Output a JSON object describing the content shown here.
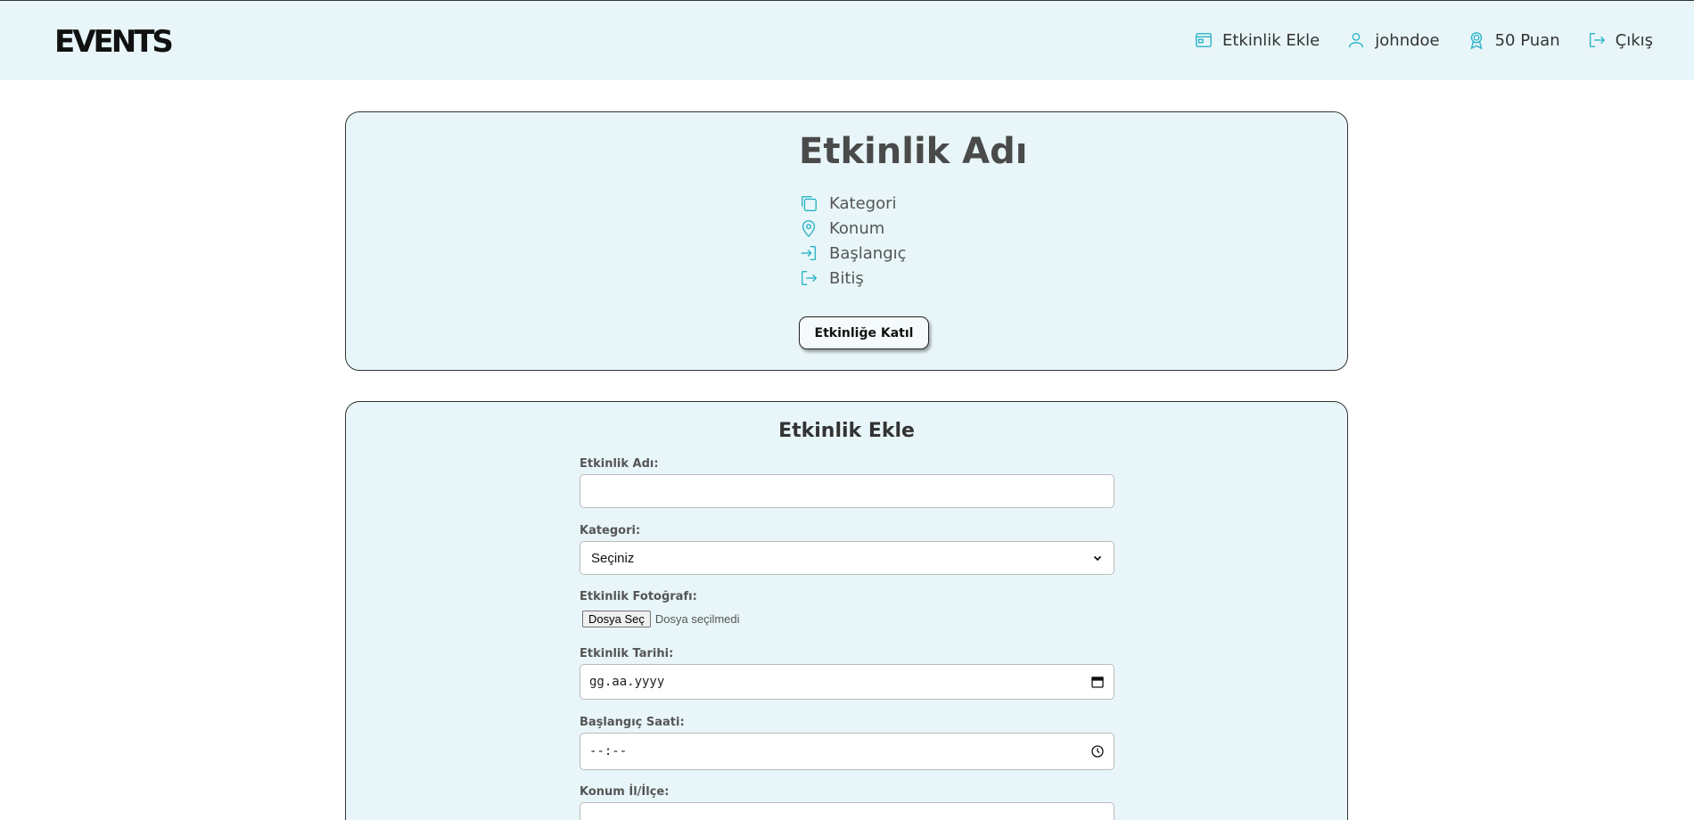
{
  "header": {
    "logo": "EVENTS",
    "nav": [
      {
        "label": "Etkinlik Ekle",
        "icon": "calendar-card-icon"
      },
      {
        "label": "johndoe",
        "icon": "user-icon"
      },
      {
        "label": "50 Puan",
        "icon": "award-icon"
      },
      {
        "label": "Çıkış",
        "icon": "logout-icon"
      }
    ]
  },
  "event_card": {
    "title": "Etkinlik Adı",
    "meta": [
      {
        "label": "Kategori",
        "icon": "copy-icon"
      },
      {
        "label": "Konum",
        "icon": "map-pin-icon"
      },
      {
        "label": "Başlangıç",
        "icon": "sign-in-icon"
      },
      {
        "label": "Bitiş",
        "icon": "sign-out-icon"
      }
    ],
    "join_button": "Etkinliğe Katıl"
  },
  "form": {
    "title": "Etkinlik Ekle",
    "name_label": "Etkinlik Adı:",
    "name_value": "",
    "category_label": "Kategori:",
    "category_value": "Seçiniz",
    "photo_label": "Etkinlik Fotoğrafı:",
    "photo_button": "Dosya Seç",
    "photo_status": "Dosya seçilmedi",
    "date_label": "Etkinlik Tarihi:",
    "date_placeholder": "gg.aa.yyyy",
    "start_time_label": "Başlangıç Saati:",
    "start_time_placeholder": "--:--",
    "location_label": "Konum İl/İlçe:",
    "location_value": ""
  },
  "colors": {
    "accent": "#2bb3c6",
    "panel_bg": "#e8f6f9"
  }
}
